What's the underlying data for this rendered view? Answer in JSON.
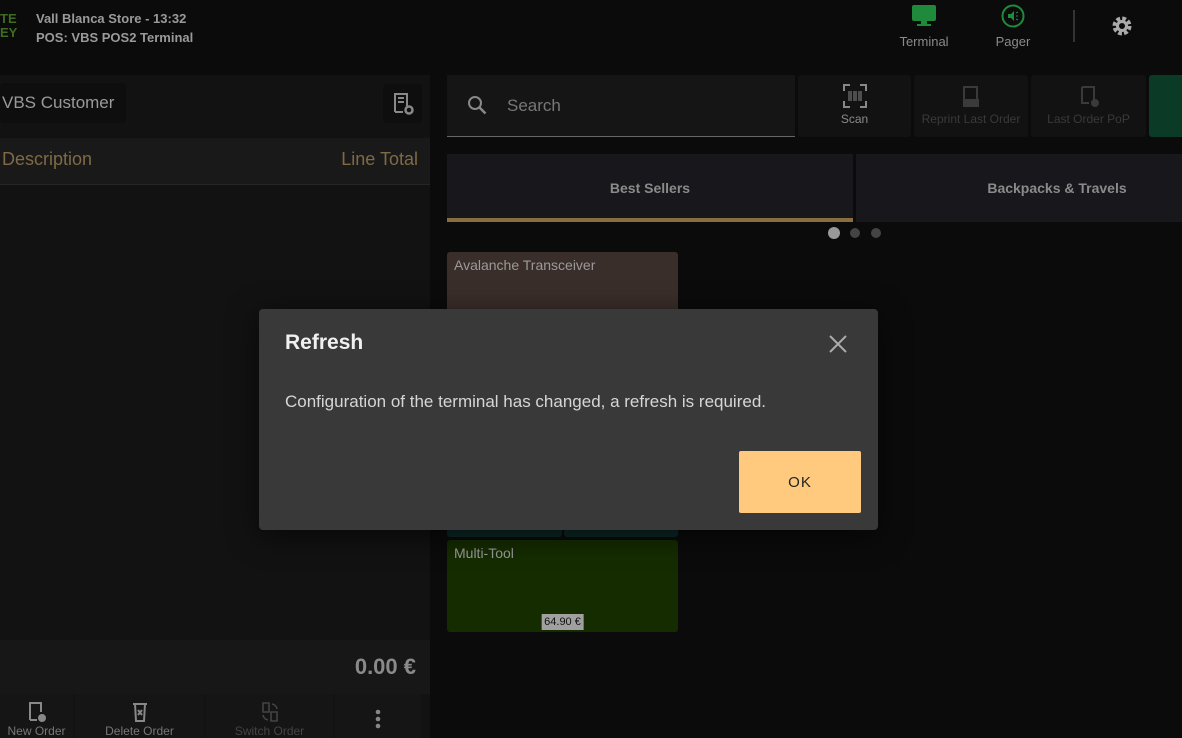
{
  "header": {
    "logo_line1": "TE",
    "logo_line2": "EY",
    "store": "Vall Blanca Store - 13:32",
    "pos": "POS: VBS POS2 Terminal",
    "terminal": "Terminal",
    "pager": "Pager",
    "accent": "#1f8a3c"
  },
  "order": {
    "customer": "VBS Customer",
    "col_description": "Description",
    "col_line_total": "Line Total",
    "total": "0.00 €",
    "buttons": [
      "New Order",
      "Delete Order",
      "Switch Order"
    ]
  },
  "products": {
    "search_placeholder": "Search",
    "scan": "Scan",
    "reprint": "Reprint Last Order",
    "last_pop": "Last Order PoP",
    "tabs": [
      "Best Sellers",
      "Backpacks & Travels"
    ],
    "tiles": [
      {
        "name": "Avalanche Transceiver"
      },
      {
        "name": "Multi-Tool",
        "price": "64.90 €"
      }
    ]
  },
  "dialog": {
    "title": "Refresh",
    "message": "Configuration of the terminal has changed, a refresh is required.",
    "ok": "OK"
  }
}
